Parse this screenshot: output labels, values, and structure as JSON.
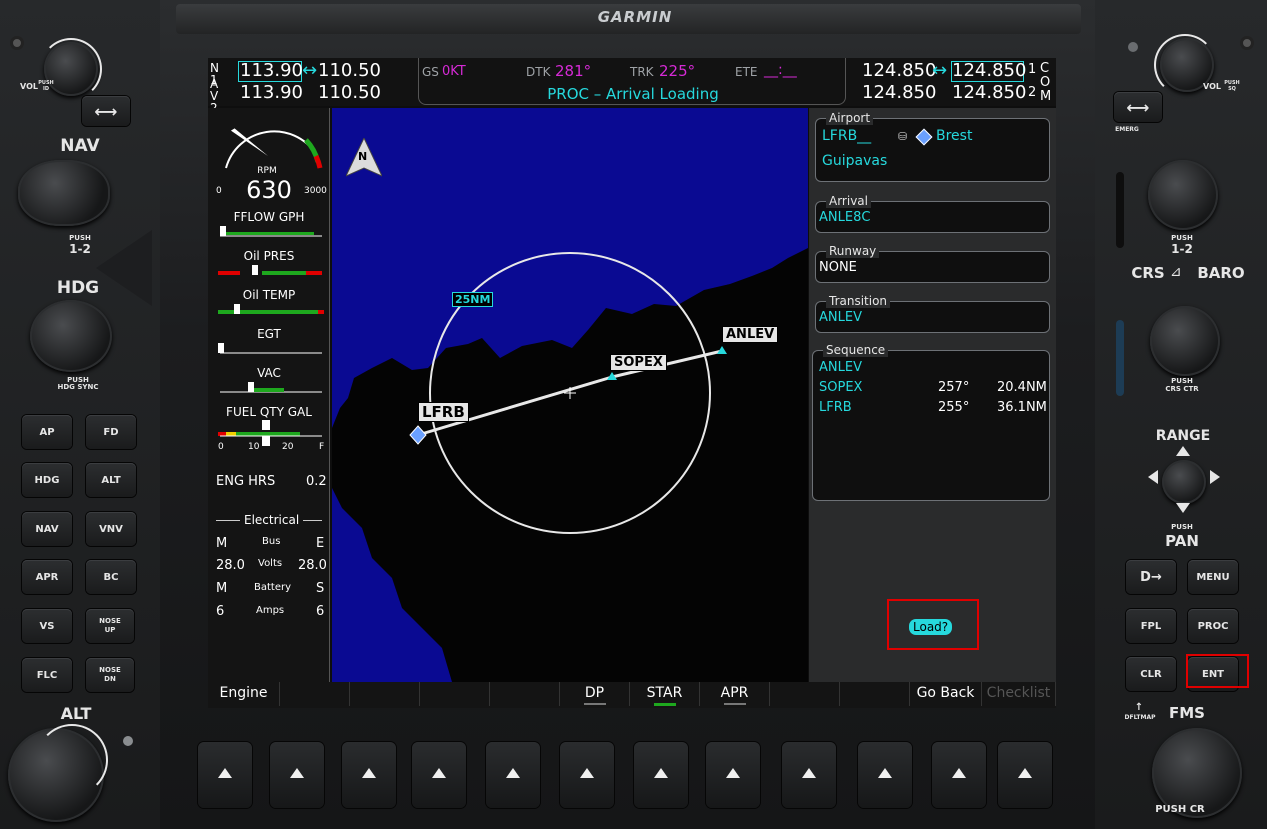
{
  "brand": "GARMIN",
  "nav_radio": {
    "label_top": "N 1",
    "label_bot": "A V 2",
    "active1": "113.90",
    "standby1": "110.50",
    "active2": "113.90",
    "standby2": "110.50",
    "swap": "↔"
  },
  "com_radio": {
    "active1": "124.850",
    "standby1": "124.850",
    "active2": "124.850",
    "standby2": "124.850",
    "label1": "1",
    "label2": "2",
    "letters": "C O M"
  },
  "topbar": {
    "gs_label": "GS",
    "gs_value": "0KT",
    "dtk_label": "DTK",
    "dtk_value": "281°",
    "trk_label": "TRK",
    "trk_value": "225°",
    "ete_label": "ETE",
    "ete_value": "__:__",
    "status": "PROC – Arrival Loading"
  },
  "engine": {
    "rpm_label": "RPM",
    "rpm_value": "630",
    "rpm_min": "0",
    "rpm_max": "3000",
    "rpm_fraction": 0.21,
    "fflow": "FFLOW GPH",
    "oil_pres": "Oil PRES",
    "oil_temp": "Oil TEMP",
    "egt": "EGT",
    "vac": "VAC",
    "fuel_qty": "FUEL QTY GAL",
    "fuel_ticks": [
      "0",
      "10",
      "20",
      "F"
    ],
    "eng_hrs_label": "ENG HRS",
    "eng_hrs_value": "0.2",
    "electrical": "Electrical",
    "bus": "Bus",
    "m1": "M",
    "e1": "E",
    "volts_label": "Volts",
    "volts_m": "28.0",
    "volts_e": "28.0",
    "battery": "Battery",
    "m2": "M",
    "s2": "S",
    "amps_label": "Amps",
    "amps_m": "6",
    "amps_s": "6"
  },
  "map": {
    "north": "N",
    "range_label": "25NM",
    "waypoints": [
      "LFRB",
      "SOPEX",
      "ANLEV"
    ]
  },
  "proc": {
    "airport_title": "Airport",
    "airport_ident": "LFRB__",
    "airport_city": "Brest",
    "airport_name": "Guipavas",
    "arrival_title": "Arrival",
    "arrival_value": "ANLE8C",
    "runway_title": "Runway",
    "runway_value": "NONE",
    "transition_title": "Transition",
    "transition_value": "ANLEV",
    "sequence_title": "Sequence",
    "sequence": [
      {
        "wpt": "ANLEV",
        "crs": "",
        "dist": ""
      },
      {
        "wpt": "SOPEX",
        "crs": "257°",
        "dist": "20.4NM"
      },
      {
        "wpt": "LFRB",
        "crs": "255°",
        "dist": "36.1NM"
      }
    ],
    "load_prompt": "Load?"
  },
  "softkeys": [
    "Engine",
    "",
    "",
    "",
    "",
    "DP",
    "STAR",
    "APR",
    "",
    "",
    "Go Back",
    "Checklist"
  ],
  "left_panel": {
    "vol": "VOL",
    "vol_push": "PUSH ID",
    "nav": "NAV",
    "nav_push": "PUSH",
    "nav_12": "1-2",
    "hdg": "HDG",
    "hdg_push": "PUSH",
    "hdg_sync": "HDG SYNC",
    "alt": "ALT",
    "buttons": [
      "AP",
      "FD",
      "HDG",
      "ALT",
      "NAV",
      "VNV",
      "APR",
      "BC",
      "VS",
      "NOSE UP",
      "FLC",
      "NOSE DN"
    ]
  },
  "right_panel": {
    "vol": "VOL",
    "vol_push": "PUSH SQ",
    "emerg": "EMERG",
    "push": "PUSH",
    "push_12": "1-2",
    "crs": "CRS",
    "baro": "BARO",
    "crs_push": "PUSH",
    "crs_ctr": "CRS CTR",
    "range": "RANGE",
    "pan_push": "PUSH",
    "pan": "PAN",
    "buttons": [
      "D→",
      "MENU",
      "FPL",
      "PROC",
      "CLR",
      "ENT"
    ],
    "dfltmap": "DFLTMAP",
    "fms": "FMS",
    "fms_push": "PUSH CR"
  },
  "colors": {
    "cyan": "#26d9dd",
    "magenta": "#d62ad6",
    "highlight": "#e00000",
    "map_water": "#0a0a92"
  }
}
